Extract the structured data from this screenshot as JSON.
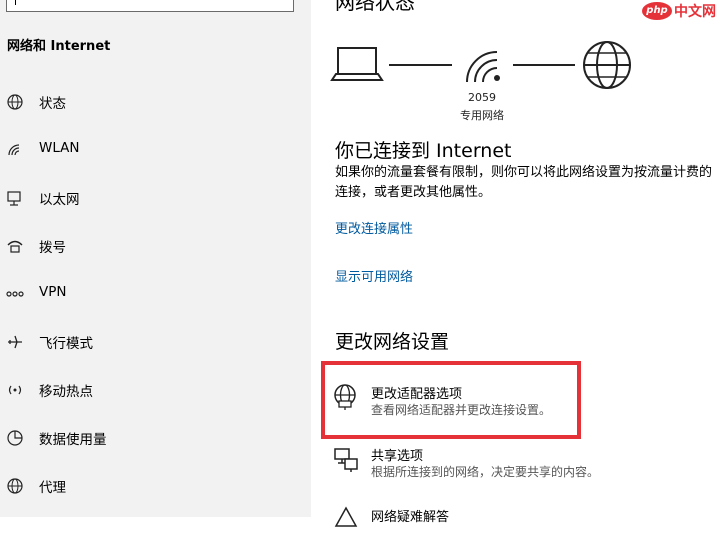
{
  "sidebar": {
    "search": {
      "placeholder": ""
    },
    "section_title": "网络和 Internet",
    "items": [
      {
        "label": "状态",
        "icon": "status-globe-icon"
      },
      {
        "label": "WLAN",
        "icon": "wifi-icon"
      },
      {
        "label": "以太网",
        "icon": "ethernet-icon"
      },
      {
        "label": "拨号",
        "icon": "dialup-icon"
      },
      {
        "label": "VPN",
        "icon": "vpn-icon"
      },
      {
        "label": "飞行模式",
        "icon": "airplane-icon"
      },
      {
        "label": "移动热点",
        "icon": "hotspot-icon"
      },
      {
        "label": "数据使用量",
        "icon": "data-usage-icon"
      },
      {
        "label": "代理",
        "icon": "proxy-globe-icon"
      }
    ]
  },
  "main": {
    "header": "网络状态",
    "diagram": {
      "network_name": "2059",
      "network_type": "专用网络"
    },
    "connected_title": "你已连接到 Internet",
    "connected_desc": "如果你的流量套餐有限制，则你可以将此网络设置为按流量计费的连接，或者更改其他属性。",
    "link_properties": "更改连接属性",
    "link_show_networks": "显示可用网络",
    "change_title": "更改网络设置",
    "options": [
      {
        "title": "更改适配器选项",
        "desc": "查看网络适配器并更改连接设置。",
        "icon": "adapter-globe-icon"
      },
      {
        "title": "共享选项",
        "desc": "根据所连接到的网络，决定要共享的内容。",
        "icon": "sharing-icon"
      },
      {
        "title": "网络疑难解答",
        "desc": "",
        "icon": "troubleshoot-icon"
      }
    ]
  },
  "watermark": {
    "logo": "php",
    "text": "中文网"
  },
  "colors": {
    "link": "#005a9e",
    "highlight": "#e53239",
    "sidebar_bg": "#f2f2f2"
  }
}
